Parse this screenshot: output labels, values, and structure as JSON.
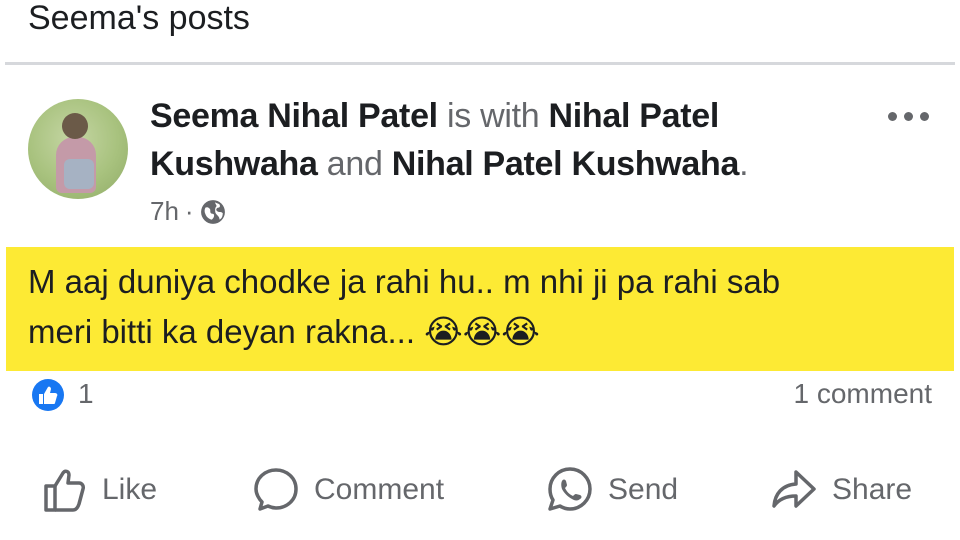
{
  "section": {
    "title": "Seema's posts"
  },
  "post": {
    "author": "Seema Nihal Patel",
    "with_text": "is with",
    "tagged_1": "Nihal Patel Kushwaha",
    "and_text": "and",
    "tagged_2": "Nihal Patel Kushwaha",
    "period": ".",
    "time": "7h",
    "separator": "·",
    "audience_icon": "globe-icon",
    "text_line_1": "M aaj duniya chodke ja rahi hu.. m nhi ji pa rahi sab",
    "text_line_2": "meri bitti ka deyan rakna... 😭😭😭",
    "background_color": "#fdea34"
  },
  "stats": {
    "like_count": "1",
    "comment_count": "1 comment"
  },
  "actions": {
    "like": "Like",
    "comment": "Comment",
    "send": "Send",
    "share": "Share"
  },
  "colors": {
    "brand_blue": "#1877f2",
    "muted": "#65676b",
    "text": "#1c1e21"
  }
}
